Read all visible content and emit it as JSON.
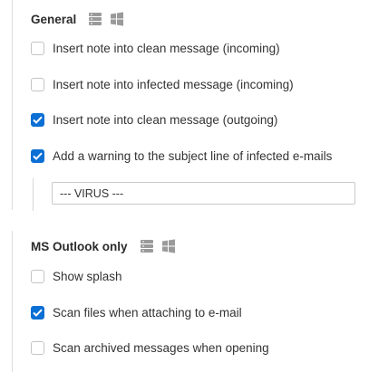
{
  "sections": [
    {
      "title": "General",
      "icons": [
        "server-icon",
        "windows-icon"
      ],
      "options": [
        {
          "label": "Insert note into clean message (incoming)",
          "checked": false
        },
        {
          "label": "Insert note into infected message (incoming)",
          "checked": false
        },
        {
          "label": "Insert note into clean message (outgoing)",
          "checked": true
        },
        {
          "label": "Add a warning to the subject line of infected e-mails",
          "checked": true
        }
      ],
      "subject_warning": {
        "value": "--- VIRUS ---"
      }
    },
    {
      "title": "MS Outlook only",
      "icons": [
        "server-icon",
        "windows-icon"
      ],
      "options": [
        {
          "label": "Show splash",
          "checked": false
        },
        {
          "label": "Scan files when attaching to e-mail",
          "checked": true
        },
        {
          "label": "Scan archived messages when opening",
          "checked": false
        }
      ]
    }
  ],
  "colors": {
    "accent": "#0b6fd4",
    "icon": "#9a9a9a",
    "border": "#c4c4c4"
  }
}
